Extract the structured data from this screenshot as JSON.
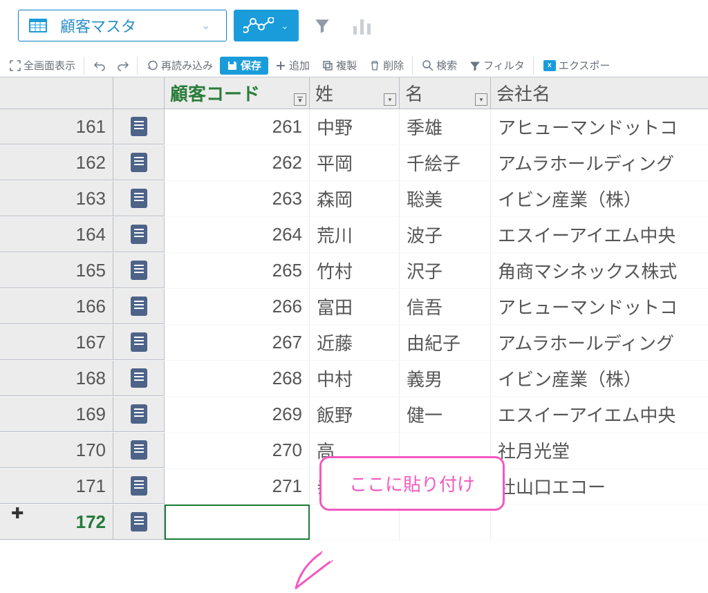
{
  "selector": {
    "label": "顧客マスタ"
  },
  "toolbar": {
    "fullscreen": "全画面表示",
    "reload": "再読み込み",
    "save": "保存",
    "add": "追加",
    "duplicate": "複製",
    "delete": "削除",
    "search": "検索",
    "filter": "フィルタ",
    "export": "エクスポー"
  },
  "columns": {
    "code": "顧客コード",
    "sei": "姓",
    "mei": "名",
    "company": "会社名"
  },
  "rows": [
    {
      "n": "161",
      "code": "261",
      "sei": "中野",
      "mei": "季雄",
      "company": "アヒューマンドットコ"
    },
    {
      "n": "162",
      "code": "262",
      "sei": "平岡",
      "mei": "千絵子",
      "company": "アムラホールディング"
    },
    {
      "n": "163",
      "code": "263",
      "sei": "森岡",
      "mei": "聡美",
      "company": "イビン産業（株）"
    },
    {
      "n": "164",
      "code": "264",
      "sei": "荒川",
      "mei": "波子",
      "company": "エスイーアイエム中央"
    },
    {
      "n": "165",
      "code": "265",
      "sei": "竹村",
      "mei": "沢子",
      "company": "角商マシネックス株式"
    },
    {
      "n": "166",
      "code": "266",
      "sei": "富田",
      "mei": "信吾",
      "company": "アヒューマンドットコ"
    },
    {
      "n": "167",
      "code": "267",
      "sei": "近藤",
      "mei": "由紀子",
      "company": "アムラホールディング"
    },
    {
      "n": "168",
      "code": "268",
      "sei": "中村",
      "mei": "義男",
      "company": "イビン産業（株）"
    },
    {
      "n": "169",
      "code": "269",
      "sei": "飯野",
      "mei": "健一",
      "company": "エスイーアイエム中央"
    },
    {
      "n": "170",
      "code": "270",
      "sei": "高",
      "mei": "",
      "company": "社月光堂"
    },
    {
      "n": "171",
      "code": "271",
      "sei": "亲",
      "mei": "",
      "company": "社山口エコー"
    }
  ],
  "newrow": {
    "n": "172"
  },
  "callout": "ここに貼り付け"
}
